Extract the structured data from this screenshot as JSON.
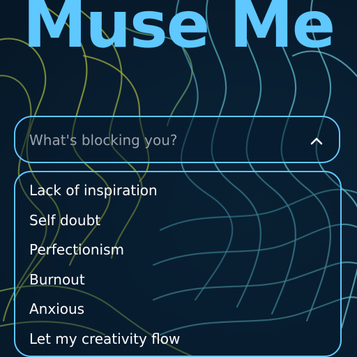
{
  "app": {
    "title": "Muse Me"
  },
  "colors": {
    "accent": "#5fc8ff",
    "background": "#071c2e",
    "placeholder": "#9aa3ad",
    "option_text": "#ffffff"
  },
  "blocker_select": {
    "placeholder": "What's blocking you?",
    "icon": "chevron-up-icon",
    "expanded": true,
    "options": [
      "Lack of inspiration",
      "Self doubt",
      "Perfectionism",
      "Burnout",
      "Anxious",
      "Let my creativity flow"
    ]
  },
  "background_art": {
    "icon": "topographic-contour-lines"
  }
}
